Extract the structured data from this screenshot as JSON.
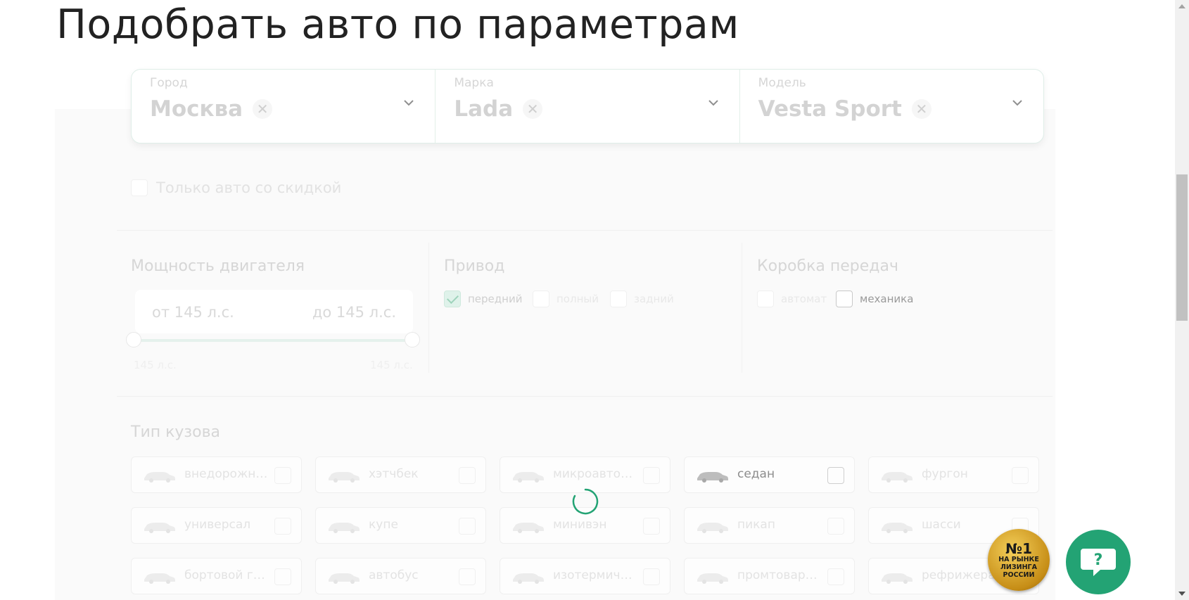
{
  "page": {
    "title": "Подобрать авто по параметрам"
  },
  "selectors": [
    {
      "label": "Город",
      "value": "Москва"
    },
    {
      "label": "Марка",
      "value": "Lada"
    },
    {
      "label": "Модель",
      "value": "Vesta Sport"
    }
  ],
  "discount_only": {
    "label": "Только авто со скидкой",
    "checked": false
  },
  "engine_power": {
    "title": "Мощность двигателя",
    "from": "от 145 л.с.",
    "to": "до 145 л.с.",
    "min_label": "145 л.с.",
    "max_label": "145 л.с."
  },
  "drive": {
    "title": "Привод",
    "options": [
      {
        "label": "передний",
        "checked": true
      },
      {
        "label": "полный",
        "checked": false
      },
      {
        "label": "задний",
        "checked": false
      }
    ]
  },
  "gearbox": {
    "title": "Коробка передач",
    "options": [
      {
        "label": "автомат",
        "checked": false
      },
      {
        "label": "механика",
        "checked": false
      }
    ]
  },
  "body_type": {
    "title": "Тип кузова",
    "items": [
      {
        "label": "внедорожник",
        "active": false
      },
      {
        "label": "хэтчбек",
        "active": false
      },
      {
        "label": "микроавтобус",
        "active": false
      },
      {
        "label": "седан",
        "active": true
      },
      {
        "label": "фургон",
        "active": false
      },
      {
        "label": "универсал",
        "active": false
      },
      {
        "label": "купе",
        "active": false
      },
      {
        "label": "минивэн",
        "active": false
      },
      {
        "label": "пикап",
        "active": false
      },
      {
        "label": "шасси",
        "active": false
      },
      {
        "label": "бортовой гру...",
        "active": false
      },
      {
        "label": "автобус",
        "active": false
      },
      {
        "label": "изотермическ...",
        "active": false
      },
      {
        "label": "промтоварны...",
        "active": false
      },
      {
        "label": "рефрижера",
        "active": false
      }
    ]
  },
  "badge": {
    "number": "№1",
    "line1": "НА РЫНКЕ",
    "line2": "ЛИЗИНГА",
    "line3": "РОССИИ"
  },
  "help": {
    "symbol": "?"
  },
  "colors": {
    "accent": "#23a374",
    "badge_gold": "#d9a22b"
  }
}
